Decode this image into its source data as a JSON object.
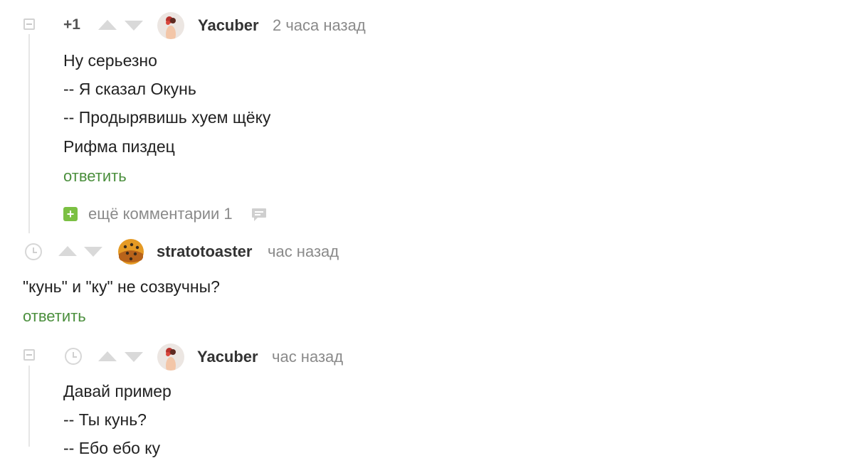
{
  "comments": [
    {
      "rating": "+1",
      "author": "Yacuber",
      "time": "2 часа назад",
      "lines": [
        "Ну серьезно",
        "-- Я сказал Окунь",
        "-- Продырявишь хуем щёку",
        "Рифма пиздец"
      ],
      "reply_label": "ответить",
      "more_comments_label": "ещё комментарии 1",
      "more_plus": "+"
    },
    {
      "author": "stratotoaster",
      "time": "час назад",
      "lines": [
        "\"кунь\" и \"ку\" не созвучны?"
      ],
      "reply_label": "ответить"
    },
    {
      "author": "Yacuber",
      "time": "час назад",
      "lines": [
        "Давай пример",
        "-- Ты кунь?",
        "-- Ебо ебо ку"
      ]
    }
  ],
  "icons": {
    "collapse": "collapse-icon",
    "clock": "clock-icon",
    "vote_up": "arrow-up-icon",
    "vote_down": "arrow-down-icon",
    "more": "plus-icon",
    "comment": "comment-bubble-icon"
  },
  "colors": {
    "reply_link": "#4b8f3d",
    "plus_badge": "#7bc043",
    "muted_text": "#8a8a8a",
    "vote_arrows": "#d9d9d9"
  }
}
